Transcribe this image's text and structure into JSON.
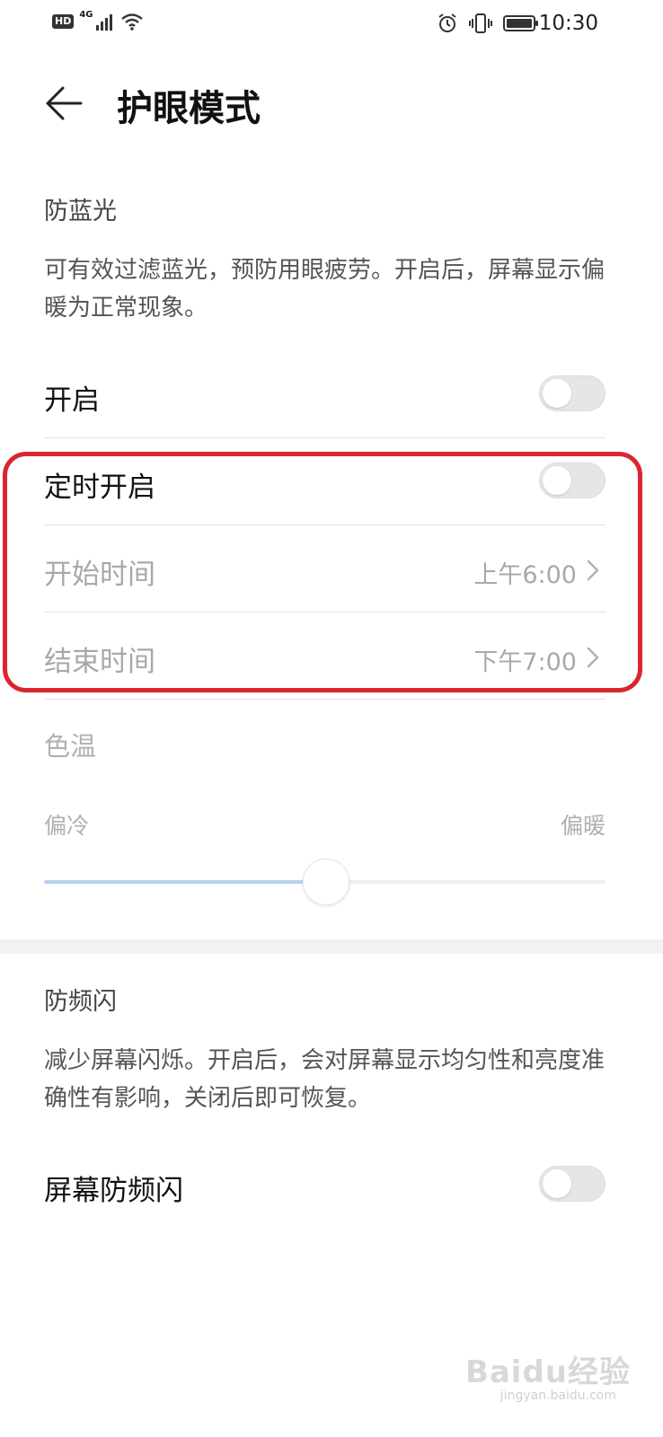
{
  "status_bar": {
    "network_badge": "HD",
    "network_type": "4G",
    "time": "10:30"
  },
  "header": {
    "title": "护眼模式"
  },
  "blue_light": {
    "section_title": "防蓝光",
    "description": "可有效过滤蓝光，预防用眼疲劳。开启后，屏幕显示偏暖为正常现象。",
    "enable_label": "开启",
    "enable_on": false,
    "schedule_label": "定时开启",
    "schedule_on": false,
    "start_label": "开始时间",
    "start_value": "上午6:00",
    "end_label": "结束时间",
    "end_value": "下午7:00"
  },
  "color_temp": {
    "title": "色温",
    "min_label": "偏冷",
    "max_label": "偏暖",
    "value_fraction": 0.5
  },
  "flicker": {
    "section_title": "防频闪",
    "description": "减少屏幕闪烁。开启后，会对屏幕显示均匀性和亮度准确性有影响，关闭后即可恢复。",
    "toggle_label": "屏幕防频闪",
    "toggle_on": false
  },
  "watermark": {
    "text": "Baidu经验",
    "sub": "jingyan.baidu.com"
  },
  "colors": {
    "highlight": "#d9262f",
    "slider_fill": "#b7d3f0"
  }
}
